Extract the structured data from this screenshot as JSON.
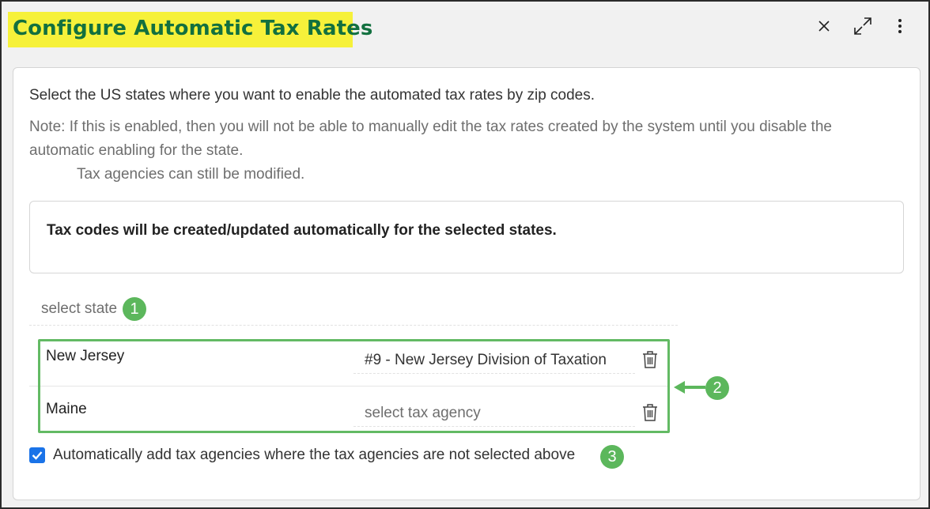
{
  "header": {
    "title": "Configure Automatic Tax Rates",
    "close_icon": "close-icon",
    "expand_icon": "expand-icon",
    "more_icon": "more-vertical-icon"
  },
  "content": {
    "intro": "Select the US states where you want to enable the automated tax rates by zip codes.",
    "note_line1": "Note: If this is enabled, then you will not be able to manually edit the tax rates created by the system until you disable the",
    "note_line2": "automatic enabling for the state.",
    "note_line3": "Tax agencies can still be modified.",
    "info_box": "Tax codes will be created/updated automatically for the selected states."
  },
  "state_select": {
    "placeholder": "select state"
  },
  "state_rows": [
    {
      "state": "New Jersey",
      "agency": "#9 - New Jersey Division of Taxation",
      "agency_is_placeholder": false
    },
    {
      "state": "Maine",
      "agency": "select tax agency",
      "agency_is_placeholder": true
    }
  ],
  "checkbox": {
    "checked": true,
    "label": "Automatically add tax agencies where the tax agencies are not selected above"
  },
  "annotations": [
    "1",
    "2",
    "3"
  ],
  "colors": {
    "title_highlight": "#f6f13a",
    "title_text": "#12703f",
    "annotation_green": "#5cb75c",
    "checkbox_blue": "#1a73e8"
  }
}
